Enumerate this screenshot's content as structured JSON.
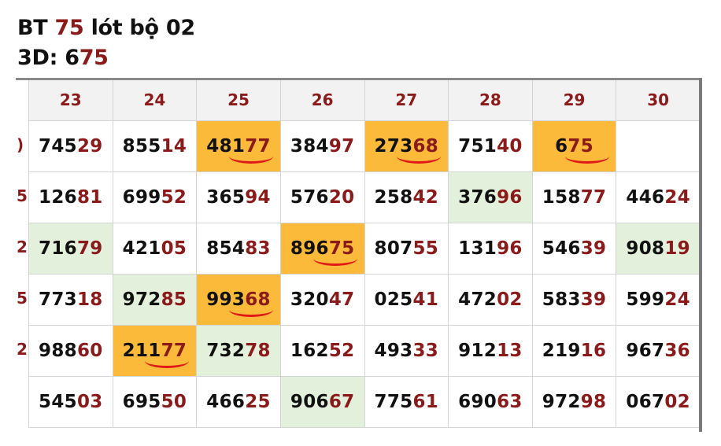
{
  "header": {
    "line1_prefix": "BT ",
    "line1_number": "75",
    "line1_suffix": " lót bộ 02",
    "line2_prefix": "3D: 6",
    "line2_number": "75"
  },
  "columns": [
    "23",
    "24",
    "25",
    "26",
    "27",
    "28",
    "29",
    "30"
  ],
  "rows": [
    {
      "edge": ")",
      "cells": [
        {
          "head": "745",
          "tail": "29",
          "hl": ""
        },
        {
          "head": "855",
          "tail": "14",
          "hl": ""
        },
        {
          "head": "481",
          "tail": "77",
          "hl": "orange",
          "marked": true
        },
        {
          "head": "384",
          "tail": "97",
          "hl": ""
        },
        {
          "head": "273",
          "tail": "68",
          "hl": "orange",
          "marked": true
        },
        {
          "head": "751",
          "tail": "40",
          "hl": ""
        },
        {
          "head": "6",
          "tail": "75",
          "hl": "orange",
          "marked": true
        },
        {
          "head": "",
          "tail": "",
          "hl": ""
        }
      ]
    },
    {
      "edge": "5",
      "cells": [
        {
          "head": "126",
          "tail": "81",
          "hl": ""
        },
        {
          "head": "699",
          "tail": "52",
          "hl": ""
        },
        {
          "head": "365",
          "tail": "94",
          "hl": ""
        },
        {
          "head": "576",
          "tail": "20",
          "hl": ""
        },
        {
          "head": "258",
          "tail": "42",
          "hl": ""
        },
        {
          "head": "376",
          "tail": "96",
          "hl": "green"
        },
        {
          "head": "158",
          "tail": "77",
          "hl": ""
        },
        {
          "head": "446",
          "tail": "24",
          "hl": ""
        }
      ]
    },
    {
      "edge": "2",
      "cells": [
        {
          "head": "716",
          "tail": "79",
          "hl": "green"
        },
        {
          "head": "421",
          "tail": "05",
          "hl": ""
        },
        {
          "head": "854",
          "tail": "83",
          "hl": ""
        },
        {
          "head": "896",
          "tail": "75",
          "hl": "orange",
          "marked": true
        },
        {
          "head": "807",
          "tail": "55",
          "hl": ""
        },
        {
          "head": "131",
          "tail": "96",
          "hl": ""
        },
        {
          "head": "546",
          "tail": "39",
          "hl": ""
        },
        {
          "head": "908",
          "tail": "19",
          "hl": "green"
        }
      ]
    },
    {
      "edge": "5",
      "cells": [
        {
          "head": "773",
          "tail": "18",
          "hl": ""
        },
        {
          "head": "972",
          "tail": "85",
          "hl": "green"
        },
        {
          "head": "993",
          "tail": "68",
          "hl": "orange",
          "marked": true
        },
        {
          "head": "320",
          "tail": "47",
          "hl": ""
        },
        {
          "head": "025",
          "tail": "41",
          "hl": ""
        },
        {
          "head": "472",
          "tail": "02",
          "hl": ""
        },
        {
          "head": "583",
          "tail": "39",
          "hl": ""
        },
        {
          "head": "599",
          "tail": "24",
          "hl": ""
        }
      ]
    },
    {
      "edge": "2",
      "cells": [
        {
          "head": "988",
          "tail": "60",
          "hl": ""
        },
        {
          "head": "211",
          "tail": "77",
          "hl": "orange",
          "marked": true
        },
        {
          "head": "732",
          "tail": "78",
          "hl": "green"
        },
        {
          "head": "162",
          "tail": "52",
          "hl": ""
        },
        {
          "head": "493",
          "tail": "33",
          "hl": ""
        },
        {
          "head": "912",
          "tail": "13",
          "hl": ""
        },
        {
          "head": "219",
          "tail": "16",
          "hl": ""
        },
        {
          "head": "967",
          "tail": "36",
          "hl": ""
        }
      ]
    },
    {
      "edge": "",
      "cells": [
        {
          "head": "545",
          "tail": "03",
          "hl": ""
        },
        {
          "head": "695",
          "tail": "50",
          "hl": ""
        },
        {
          "head": "466",
          "tail": "25",
          "hl": ""
        },
        {
          "head": "906",
          "tail": "67",
          "hl": "green"
        },
        {
          "head": "775",
          "tail": "61",
          "hl": ""
        },
        {
          "head": "690",
          "tail": "63",
          "hl": ""
        },
        {
          "head": "972",
          "tail": "98",
          "hl": ""
        },
        {
          "head": "067",
          "tail": "02",
          "hl": ""
        }
      ]
    }
  ],
  "colors": {
    "accent_red": "#8b1a1a",
    "highlight_orange": "#fbba3a",
    "highlight_green": "#e3f1dc",
    "mark_red": "#e01818"
  }
}
